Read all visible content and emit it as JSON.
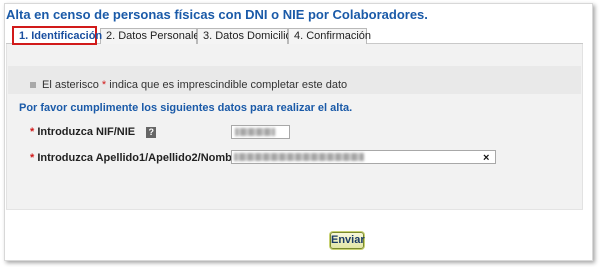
{
  "title": "Alta en censo de personas físicas con DNI o NIE por Colaboradores.",
  "tabs": [
    {
      "label": "1. Identificación",
      "active": true
    },
    {
      "label": "2. Datos Personales",
      "active": false
    },
    {
      "label": "3. Datos Domicilio",
      "active": false
    },
    {
      "label": "4. Confirmación",
      "active": false
    }
  ],
  "note": {
    "before": "El asterisco ",
    "asterisk": "*",
    "after": " indica que es imprescindible completar este dato"
  },
  "instruction": "Por favor cumplimente los siguientes datos para realizar el alta.",
  "fields": {
    "nif": {
      "asterisk": "*",
      "label": "Introduzca NIF/NIE",
      "help": "?"
    },
    "nombre": {
      "asterisk": "*",
      "label": "Introduzca Apellido1/Apellido2/Nombre",
      "clear": "×"
    }
  },
  "submit_label": "Enviar",
  "colors": {
    "accent": "#1a5aa8",
    "required": "#d11a1a",
    "active_tab_border": "#d11a1a"
  }
}
